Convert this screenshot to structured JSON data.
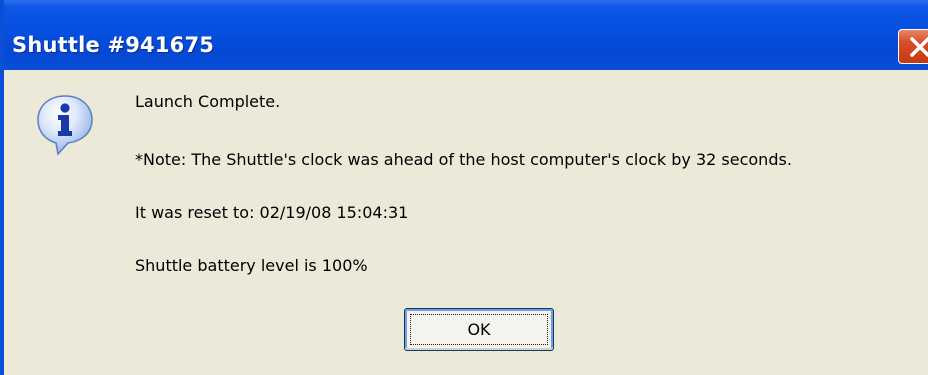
{
  "window": {
    "title": "Shuttle #941675"
  },
  "icons": {
    "info": "information-icon",
    "close": "close-icon"
  },
  "message": {
    "line1": "Launch Complete.",
    "line2": "*Note:  The Shuttle's clock was ahead of the host computer's clock by 32 seconds.",
    "line3": "It was reset to:  02/19/08  15:04:31",
    "line4": "Shuttle battery level is 100%"
  },
  "buttons": {
    "ok_label": "OK"
  },
  "colors": {
    "titlebar": "#0a4fd6",
    "dialog_bg": "#ece9d8",
    "close_button": "#d6502a",
    "title_text": "#ffffff"
  }
}
